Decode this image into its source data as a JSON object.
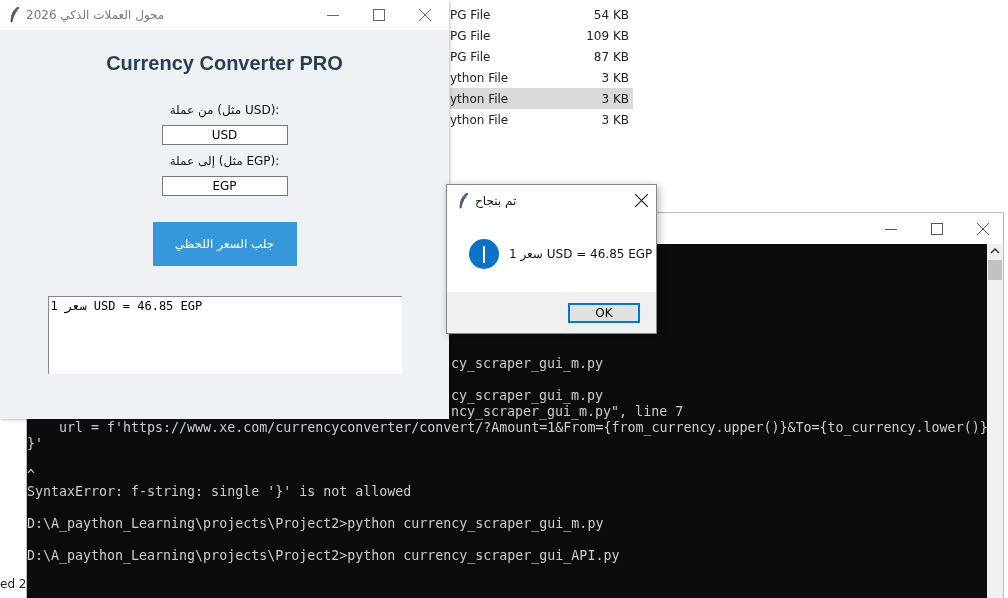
{
  "explorer": {
    "rows": [
      {
        "type": "PG File",
        "size": "54 KB",
        "selected": false
      },
      {
        "type": "PG File",
        "size": "109 KB",
        "selected": false
      },
      {
        "type": "PG File",
        "size": "87 KB",
        "selected": false
      },
      {
        "type": "ython File",
        "size": "3 KB",
        "selected": false
      },
      {
        "type": "ython File",
        "size": "3 KB",
        "selected": true
      },
      {
        "type": "ython File",
        "size": "3 KB",
        "selected": false
      }
    ],
    "status_text": "ed 2"
  },
  "console": {
    "lines": [
      {
        "text": "cy_scraper_gui_m.py",
        "kind": "tail",
        "blank_before": false
      },
      {
        "text": "cy_scraper_gui_m.py",
        "kind": "tail",
        "blank_before": true
      },
      {
        "text": "ncy_scraper_gui_m.py\", line 7",
        "kind": "tail",
        "blank_before": false
      },
      {
        "text": "    url = f'https://www.xe.com/currencyconverter/convert/?Amount=1&From={from_currency.upper()}&To={to_currency.lower()}",
        "kind": "full",
        "blank_before": false
      },
      {
        "text": "}'",
        "kind": "full",
        "blank_before": false
      },
      {
        "text": "^",
        "kind": "full",
        "blank_before": true
      },
      {
        "text": "SyntaxError: f-string: single '}' is not allowed",
        "kind": "full",
        "blank_before": false
      },
      {
        "text": "D:\\A_paython_Learning\\projects\\Project2>python currency_scraper_gui_m.py",
        "kind": "full",
        "blank_before": true
      },
      {
        "text": "D:\\A_paython_Learning\\projects\\Project2>python currency_scraper_gui_API.py",
        "kind": "full",
        "blank_before": true
      }
    ]
  },
  "app_window": {
    "title": "محول العملات الذكي 2026",
    "heading": "Currency Converter PRO",
    "from_label": "من عملة (مثل USD):",
    "from_value": "USD",
    "to_label": "إلى عملة (مثل EGP):",
    "to_value": "EGP",
    "fetch_button": "جلب السعر اللحظي",
    "result_text": "سعر 1 USD = 46.85 EGP"
  },
  "dialog": {
    "title": "تم بنجاح",
    "message": "1 سعر USD = 46.85 EGP",
    "ok_button": "OK"
  }
}
